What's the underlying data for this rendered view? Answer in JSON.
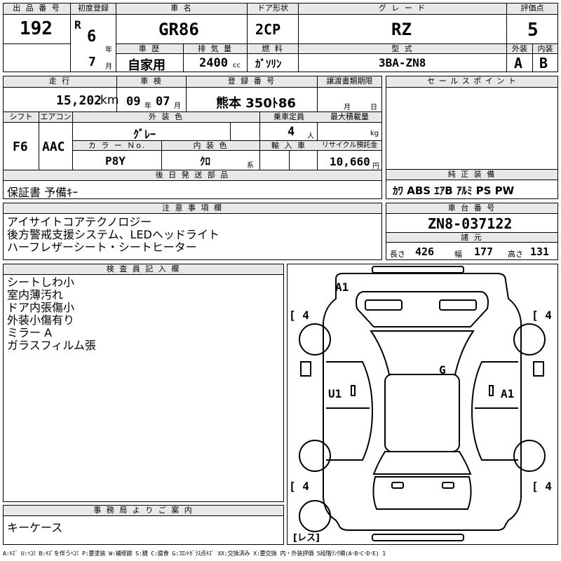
{
  "header": {
    "lot_label": "出 品 番 号",
    "lot_no": "192",
    "first_reg_label": "初度登録",
    "reg_prefix": "R",
    "reg_year": "6",
    "reg_year_unit": "年",
    "reg_month": "7",
    "reg_month_unit": "月",
    "car_name_label": "車 名",
    "car_name": "GR86",
    "door_label": "ドア形状",
    "door": "2CP",
    "grade_label": "グ レ ー ド",
    "grade": "RZ",
    "score_label": "評価点",
    "score": "5",
    "history_label": "車 歴",
    "history": "自家用",
    "displacement_label": "排 気 量",
    "displacement": "2400",
    "displacement_unit": "cc",
    "fuel_label": "燃 料",
    "fuel": "ｶﾞｿﾘﾝ",
    "model_label": "型 式",
    "model": "3BA-ZN8",
    "ext_label": "外装",
    "ext_score": "A",
    "int_label": "内装",
    "int_score": "B"
  },
  "row2": {
    "mileage_label": "走 行",
    "mileage": "15,202",
    "mileage_unit": "km",
    "inspection_label": "車 検",
    "insp_year": "09",
    "insp_year_unit": "年",
    "insp_month": "07",
    "insp_month_unit": "月",
    "plate_label": "登 録 番 号",
    "plate": "熊本 350ﾄ86",
    "transfer_label": "譲渡書類期限",
    "transfer_month": "月",
    "transfer_day": "日",
    "sales_label": "セ ー ル ス ポ イ ン ト"
  },
  "row3": {
    "shift_label": "シフト",
    "shift": "F6",
    "ac_label": "エアコン",
    "ac": "AAC",
    "ext_color_label": "外 装 色",
    "ext_color": "ｸﾞﾚｰ",
    "capacity_label": "乗車定員",
    "capacity": "4",
    "capacity_unit": "人",
    "load_label": "最大積載量",
    "load_unit": "kg",
    "color_no_label": "カ ラ ー Ｎo.",
    "color_no": "P8Y",
    "int_color_label": "内 装 色",
    "int_color": "ｸﾛ",
    "int_color_unit": "系",
    "import_label": "輸 入 車",
    "recycle_label": "リサイクル預託金",
    "recycle": "10,660",
    "recycle_unit": "円"
  },
  "later_parts": {
    "label": "後 日 発 送 部 品",
    "value": "保証書 予備ｷｰ"
  },
  "equipment": {
    "label": "純 正 装 備",
    "value": "ｶﾜ ABS ｴｱB ｱﾙﾐ PS PW"
  },
  "notes": {
    "label": "注 意 事 項 欄",
    "lines": [
      "アイサイトコアテクノロジー",
      "後方警戒支援システム、LEDヘッドライト",
      "ハーフレザーシート・シートヒーター"
    ]
  },
  "chassis": {
    "label": "車 台 番 号",
    "value": "ZN8-037122",
    "spec_label": "諸 元",
    "length_label": "長さ",
    "length": "426",
    "width_label": "幅",
    "width": "177",
    "height_label": "高さ",
    "height": "131"
  },
  "inspector": {
    "label": "検 査 員 記 入 欄",
    "lines": [
      "シートしわ小",
      "室内薄汚れ",
      "ドア内張傷小",
      "外装小傷有り",
      "ミラー A",
      "ガラスフィルム張"
    ]
  },
  "office": {
    "label": "事 務 局 よ り ご 案 内",
    "value": "キーケース"
  },
  "diagram": {
    "mark_front": "A1",
    "mark_roof": "G",
    "mark_left": "U1",
    "mark_right": "A1",
    "tire_fl": "4",
    "tire_fr": "4",
    "tire_rl": "4",
    "tire_rr": "4",
    "spare": "レス"
  },
  "legend": "A:ｷｽﾞ U:ﾍｺﾐ B:ｷｽﾞを伴うﾍｺﾐ P:要塗装 W:補修跡 S:錆 C:腐食 G:ﾌﾛﾝﾄｶﾞﾗｽ点ｷｽﾞ XX:交換済み X:要交換 内・外装評価 5段階ﾗﾝｸ順(A･B･C･D･E) 1"
}
